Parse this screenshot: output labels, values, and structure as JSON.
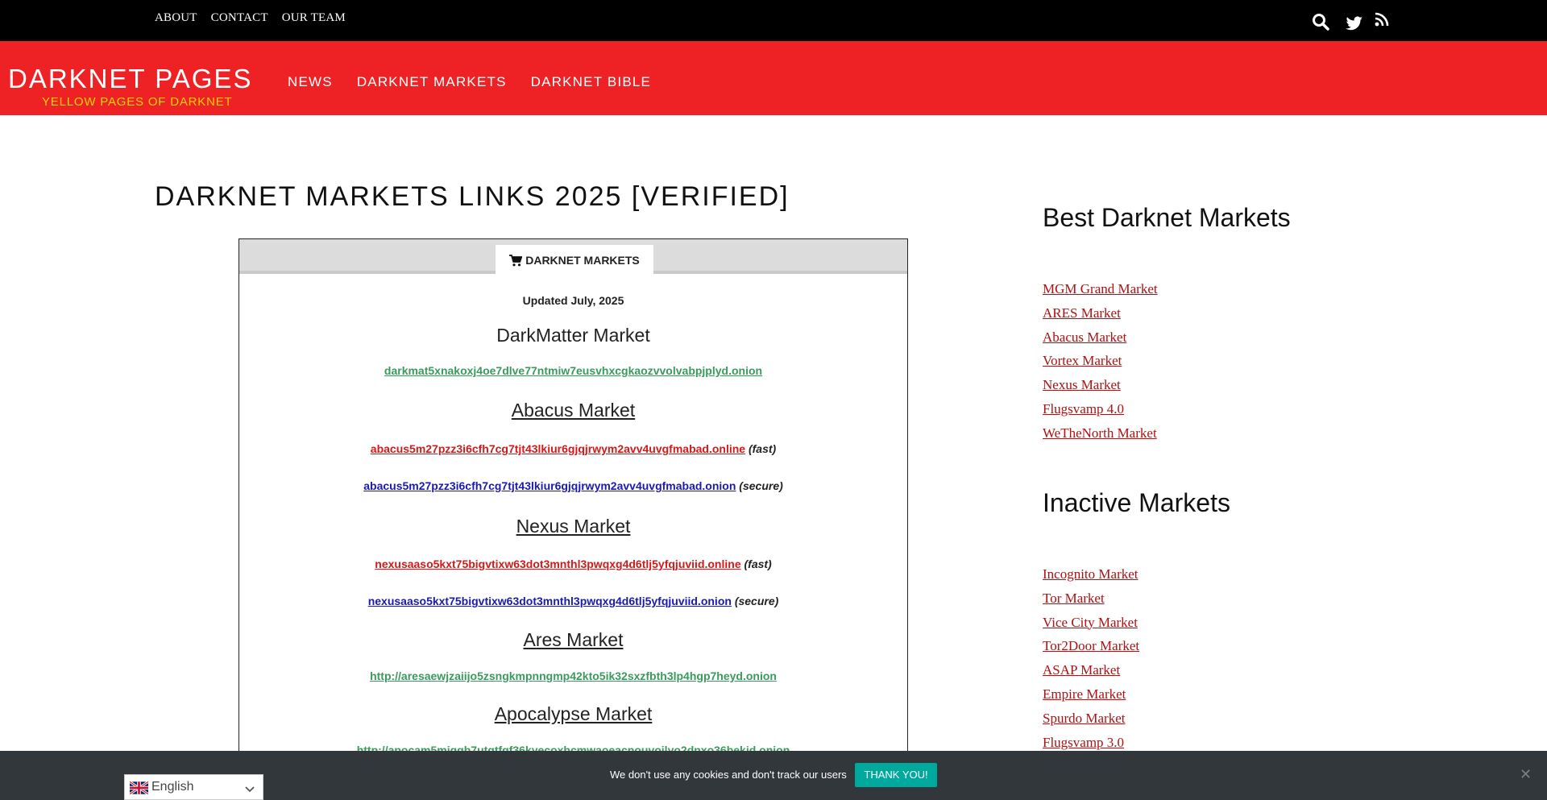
{
  "topbar": {
    "nav": [
      "ABOUT",
      "CONTACT",
      "OUR TEAM"
    ],
    "icons": [
      "search-icon",
      "twitter-icon",
      "rss-icon"
    ]
  },
  "header": {
    "brand": "DARKNET PAGES",
    "tagline": "YELLOW PAGES OF DARKNET",
    "nav": [
      "NEWS",
      "DARKNET MARKETS",
      "DARKNET BIBLE"
    ]
  },
  "main": {
    "title": "DARKNET MARKETS LINKS 2025 [VERIFIED]",
    "tab_label": "DARKNET MARKETS",
    "updated": "Updated July, 2025",
    "markets": [
      {
        "name": "DarkMatter Market",
        "links": [
          {
            "url": "darkmat5xnakoxj4oe7dlve77ntmiw7eusvhxcgkaozvvolvabpjplyd.onion",
            "note": "",
            "color": "green"
          }
        ]
      },
      {
        "name": "Abacus Market",
        "links": [
          {
            "url": "abacus5m27pzz3i6cfh7cg7tjt43lkiur6gjqjrwym2avv4uvgfmabad.online",
            "note": "(fast)",
            "color": "red"
          },
          {
            "url": "abacus5m27pzz3i6cfh7cg7tjt43lkiur6gjqjrwym2avv4uvgfmabad.onion",
            "note": "(secure)",
            "color": "blue"
          }
        ]
      },
      {
        "name": "Nexus Market",
        "links": [
          {
            "url": "nexusaaso5kxt75bigvtixw63dot3mnthl3pwqxg4d6tlj5yfqjuviid.online",
            "note": "(fast)",
            "color": "red"
          },
          {
            "url": "nexusaaso5kxt75bigvtixw63dot3mnthl3pwqxg4d6tlj5yfqjuviid.onion",
            "note": "(secure)",
            "color": "blue"
          }
        ]
      },
      {
        "name": "Ares Market",
        "links": [
          {
            "url": "http://aresaewjzaiijo5zsngkmpnngmp42kto5ik32sxzfbth3lp4hgp7heyd.onion",
            "note": "",
            "color": "green"
          }
        ]
      },
      {
        "name": "Apocalypse Market",
        "links": [
          {
            "url": "http://apocam5miqgb7utqtfqf36kyecoxhcmwaoeacpouvoilyo2dnxo36bekid.onion",
            "note": "",
            "color": "green"
          }
        ]
      }
    ]
  },
  "sidebar": {
    "best_title": "Best Darknet Markets",
    "best": [
      "MGM Grand Market",
      "ARES Market",
      "Abacus Market",
      "Vortex Market",
      "Nexus Market",
      "Flugsvamp 4.0",
      "WeTheNorth Market"
    ],
    "inactive_title": "Inactive Markets",
    "inactive": [
      "Incognito Market",
      "Tor Market",
      "Vice City Market",
      "Tor2Door Market",
      "ASAP Market",
      "Empire Market",
      "Spurdo Market",
      "Flugsvamp 3.0"
    ]
  },
  "cookie": {
    "text": "We don't use any cookies and don't track our users",
    "button": "THANK YOU!",
    "close": "✕"
  },
  "language": {
    "label": "English"
  },
  "colors": {
    "header_red": "#ee2225",
    "tagline_yellow": "#ffd400",
    "cookie_button": "#00a99d",
    "sidebar_link": "#b01010"
  }
}
